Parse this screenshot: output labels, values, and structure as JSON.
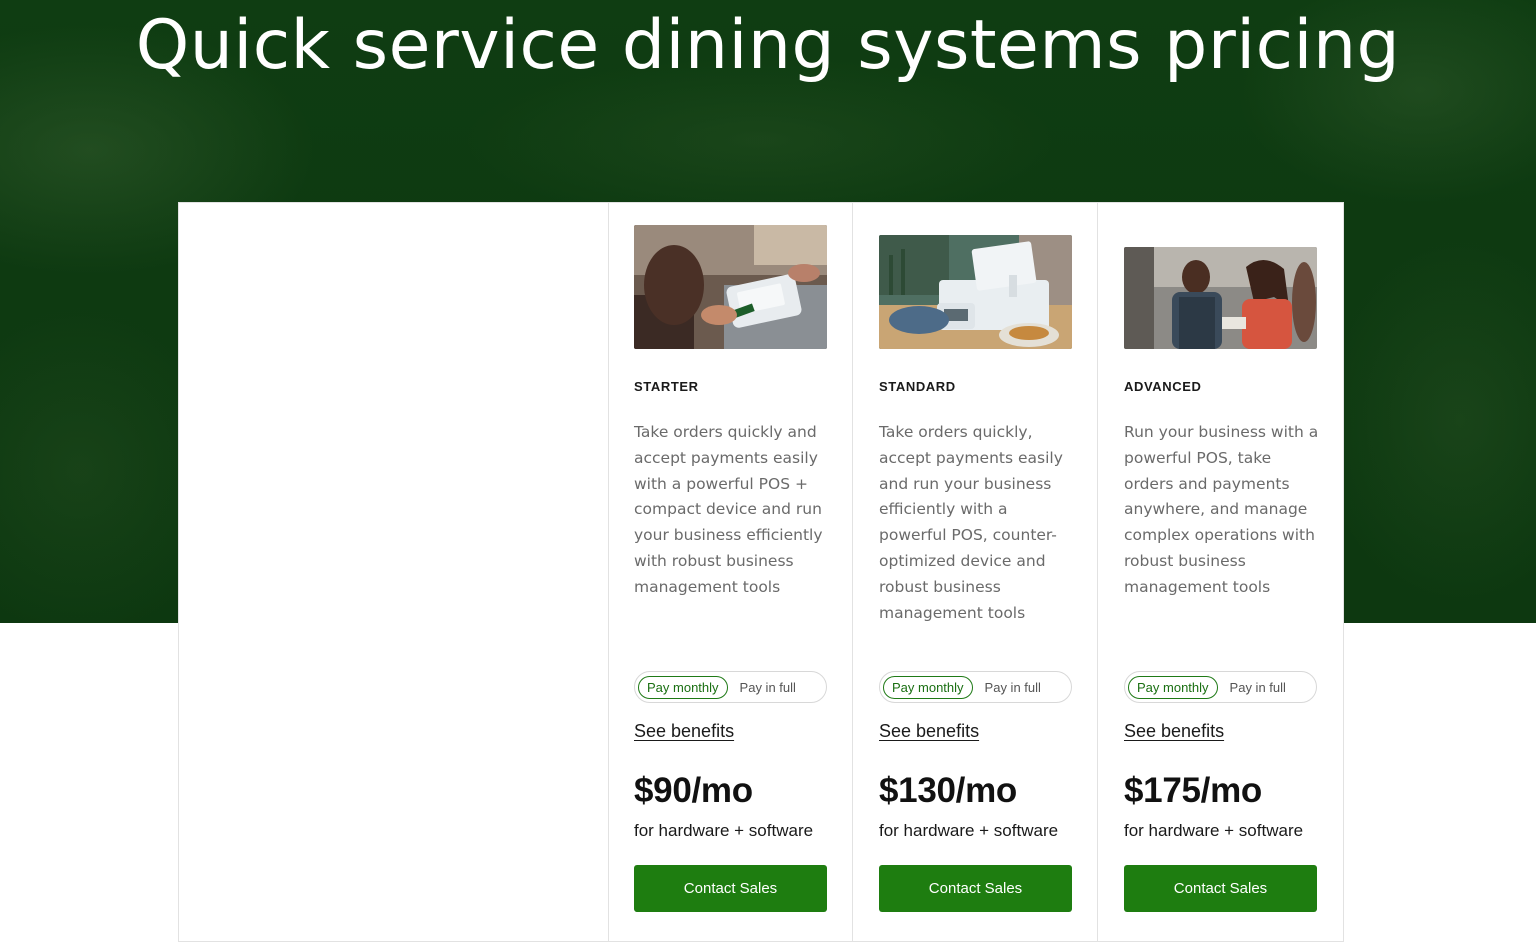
{
  "hero": {
    "title": "Quick service dining systems pricing"
  },
  "plans": [
    {
      "name": "STARTER",
      "description": "Take orders quickly and accept payments easily with a powerful POS + compact device and run your business efficiently with robust business management tools",
      "toggle": {
        "monthly": "Pay monthly",
        "full": "Pay in full",
        "selected": "monthly"
      },
      "benefits_link": "See benefits",
      "price": "$90/mo",
      "price_note": "for hardware + software",
      "cta": "Contact Sales"
    },
    {
      "name": "STANDARD",
      "description": "Take orders quickly, accept payments easily and run your business efficiently with a powerful POS, counter-optimized device and robust business management tools",
      "toggle": {
        "monthly": "Pay monthly",
        "full": "Pay in full",
        "selected": "monthly"
      },
      "benefits_link": "See benefits",
      "price": "$130/mo",
      "price_note": "for hardware + software",
      "cta": "Contact Sales"
    },
    {
      "name": "ADVANCED",
      "description": "Run your business with a powerful POS, take orders and payments anywhere, and manage complex operations with robust business management tools",
      "toggle": {
        "monthly": "Pay monthly",
        "full": "Pay in full",
        "selected": "monthly"
      },
      "benefits_link": "See benefits",
      "price": "$175/mo",
      "price_note": "for hardware + software",
      "cta": "Contact Sales"
    }
  ],
  "colors": {
    "hero_bg": "#0e3a11",
    "accent": "#1e7d10",
    "toggle_active": "#1f7a16"
  }
}
